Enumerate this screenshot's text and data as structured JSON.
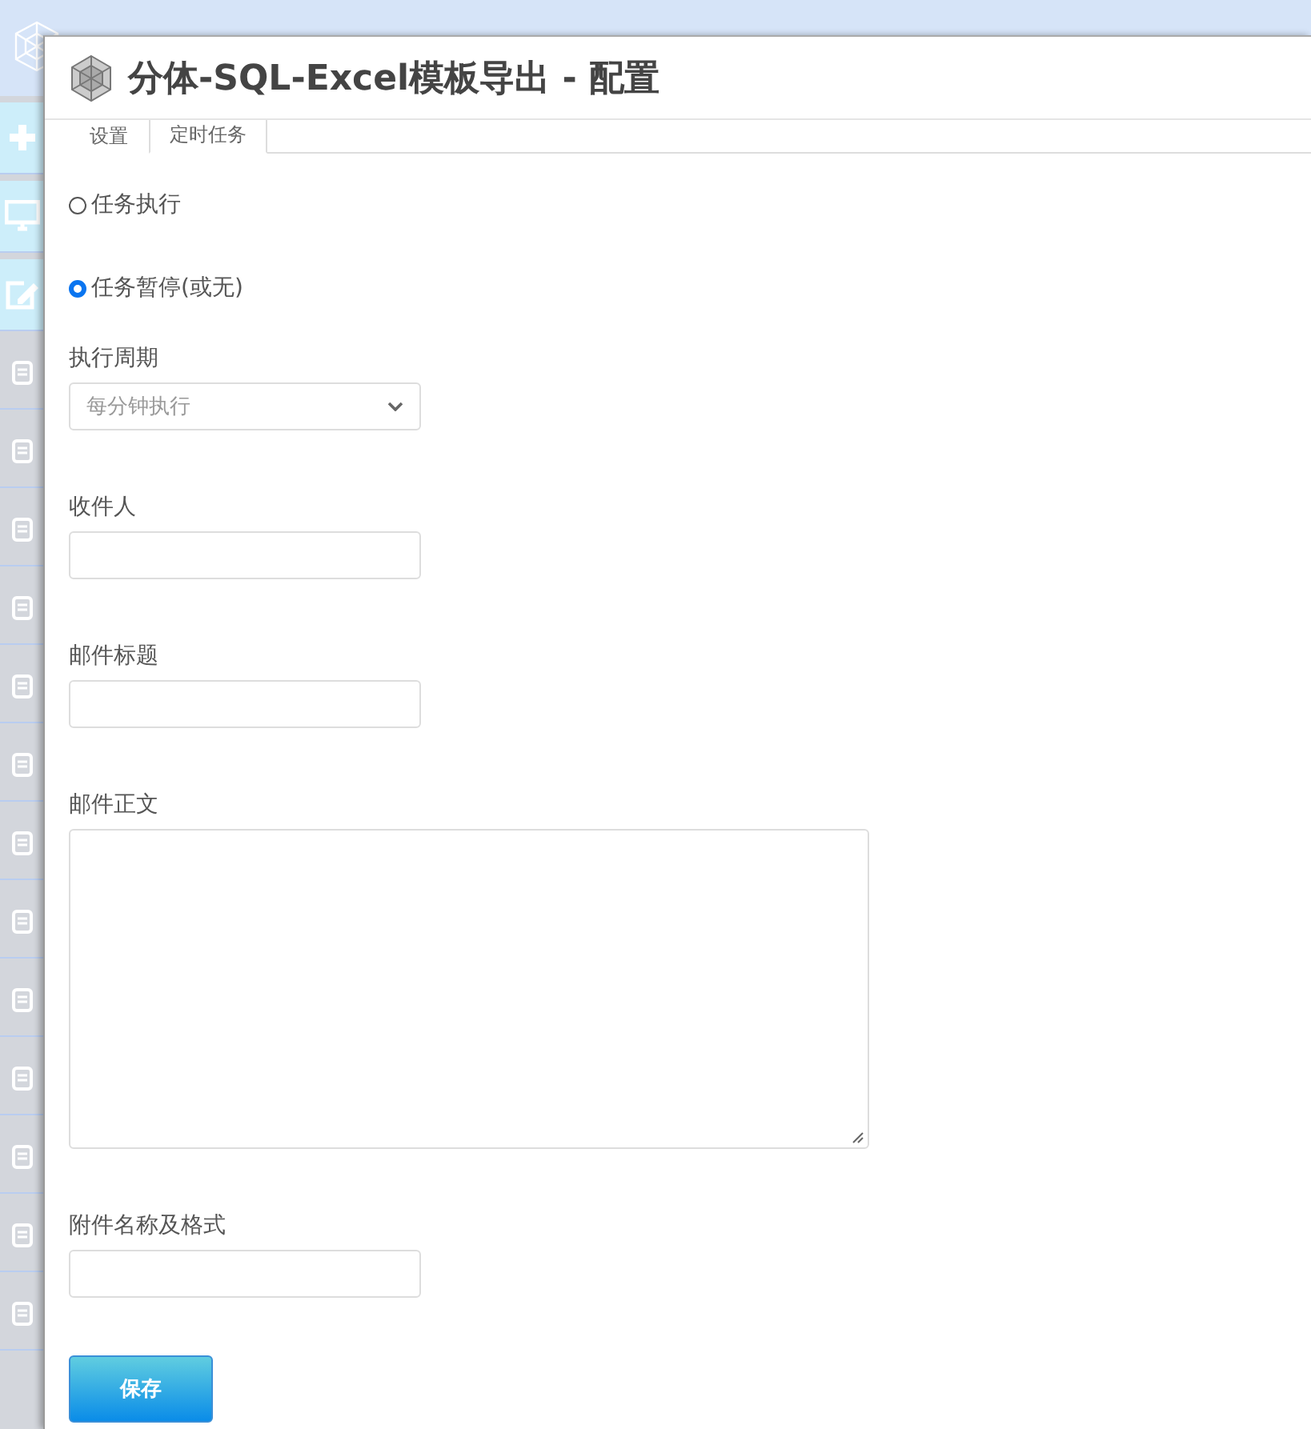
{
  "dialog": {
    "title": "分体-SQL-Excel模板导出 - 配置",
    "tabs": [
      {
        "label": "设置",
        "selected": false
      },
      {
        "label": "定时任务",
        "selected": true
      }
    ],
    "radios": [
      {
        "label": "任务执行",
        "selected": false
      },
      {
        "label": "任务暂停(或无)",
        "selected": true
      }
    ],
    "fields": [
      {
        "kind": "select",
        "label": "执行周期",
        "value": "每分钟执行"
      },
      {
        "kind": "input",
        "label": "收件人"
      },
      {
        "kind": "input",
        "label": "邮件标题"
      },
      {
        "kind": "textarea",
        "label": "邮件正文"
      },
      {
        "kind": "input",
        "label": "附件名称及格式"
      }
    ],
    "save_button": "保存"
  }
}
